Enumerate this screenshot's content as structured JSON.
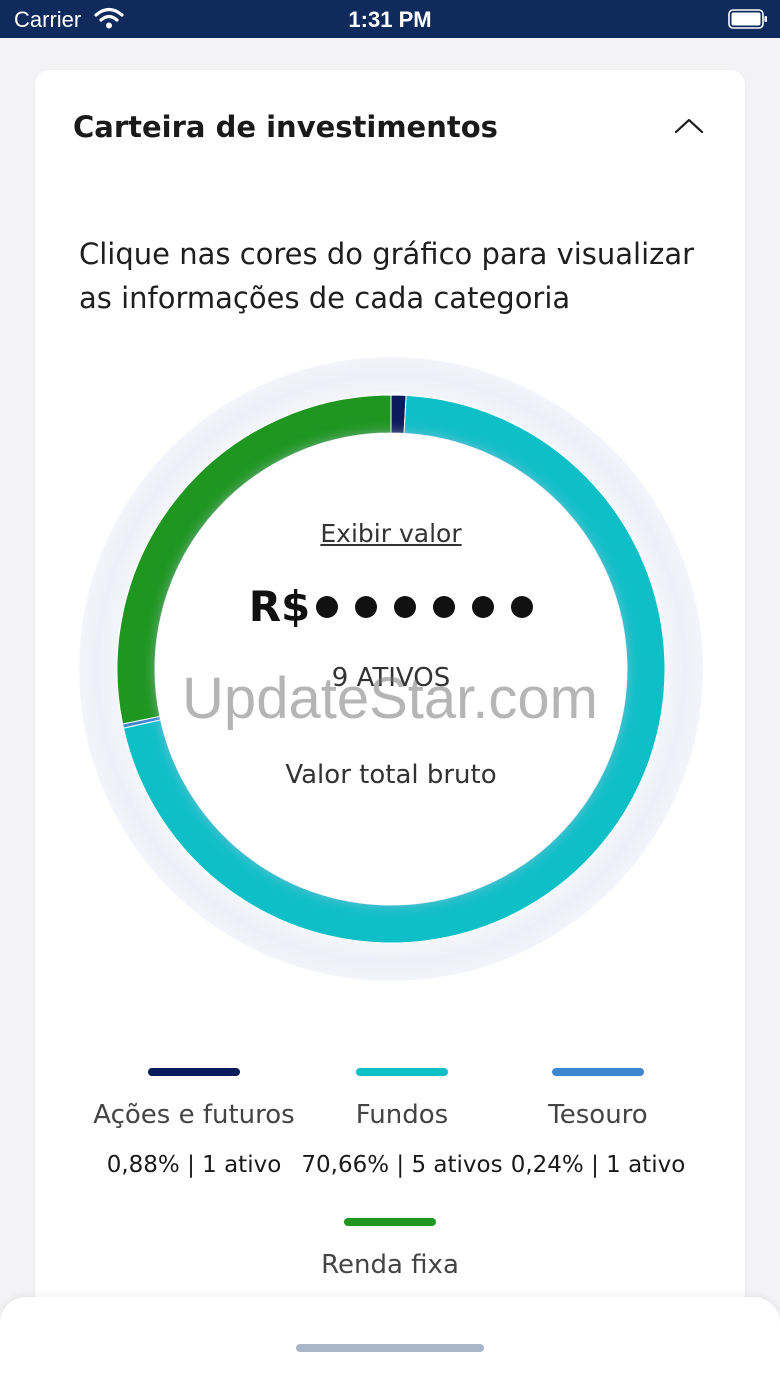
{
  "status_bar": {
    "carrier": "Carrier",
    "time": "1:31 PM",
    "icons": [
      "wifi-icon",
      "battery-icon"
    ]
  },
  "card": {
    "title": "Carteira de investimentos",
    "collapse_icon": "chevron-up-icon",
    "hint": "Clique nas cores do gráfico para visualizar as informações de cada categoria"
  },
  "summary": {
    "show_value_label": "Exibir valor",
    "currency": "R$",
    "hidden_dots": 6,
    "assets_label": "9 ATIVOS",
    "total_label": "Valor total bruto"
  },
  "watermark": "UpdateStar.com",
  "colors": {
    "acoes": "#0a1a5c",
    "fundos": "#0fbfc8",
    "tesouro": "#3e86d0",
    "renda_fixa": "#1e9620",
    "status_bar": "#0f2a5c"
  },
  "chart_data": {
    "type": "pie",
    "style": "donut",
    "slices": [
      {
        "name": "Ações e futuros",
        "percent": 0.88,
        "detail": "0,88% | 1 ativo",
        "color": "#0a1a5c"
      },
      {
        "name": "Fundos",
        "percent": 70.66,
        "detail": "70,66% | 5 ativos",
        "color": "#0fbfc8"
      },
      {
        "name": "Tesouro",
        "percent": 0.24,
        "detail": "0,24% | 1 ativo",
        "color": "#3e86d0"
      },
      {
        "name": "Renda fixa",
        "percent": 28.22,
        "detail": "",
        "color": "#1e9620"
      }
    ]
  },
  "legend": [
    {
      "name": "Ações e futuros",
      "detail": "0,88% | 1 ativo",
      "color": "#0a1a5c"
    },
    {
      "name": "Fundos",
      "detail": "70,66% | 5 ativos",
      "color": "#0fbfc8"
    },
    {
      "name": "Tesouro",
      "detail": "0,24% | 1 ativo",
      "color": "#3e86d0"
    },
    {
      "name": "Renda fixa",
      "detail": "",
      "color": "#1e9620"
    }
  ]
}
